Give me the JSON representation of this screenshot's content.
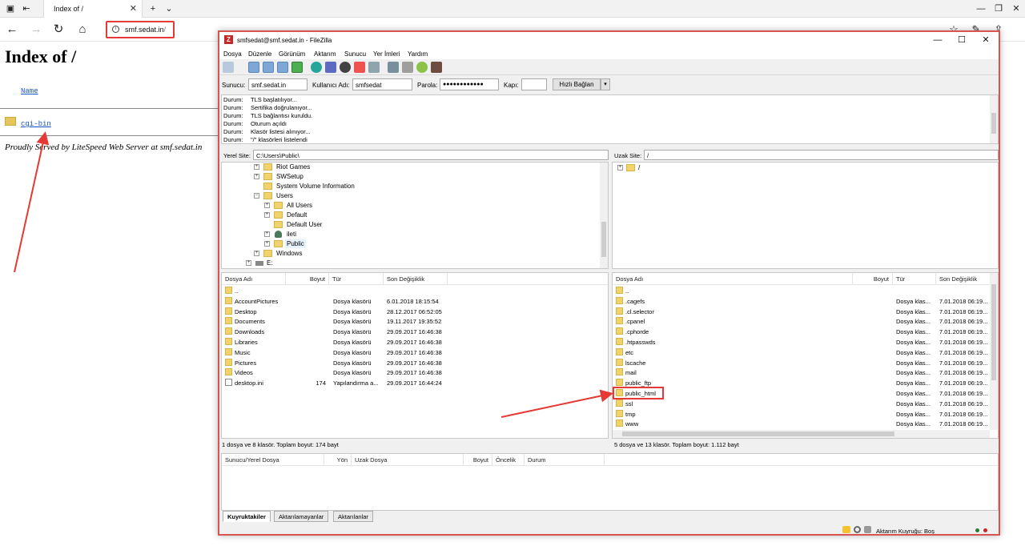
{
  "browser": {
    "tab_title": "Index of /",
    "url_host": "smf.sedat.in",
    "url_path": "/"
  },
  "page": {
    "heading": "Index of /",
    "column_name": "Name",
    "entries": [
      "cgi-bin"
    ],
    "footer": "Proudly Served by LiteSpeed Web Server at smf.sedat.in"
  },
  "filezilla": {
    "title": "smfsedat@smf.sedat.in - FileZilla",
    "menu": [
      "Dosya",
      "Düzenle",
      "Görünüm",
      "Aktarım",
      "Sunucu",
      "Yer İmleri",
      "Yardım"
    ],
    "quickconnect": {
      "host_label": "Sunucu:",
      "host_value": "smf.sedat.in",
      "user_label": "Kullanıcı Adı:",
      "user_value": "smfsedat",
      "pass_label": "Parola:",
      "pass_value": "●●●●●●●●●●●●",
      "port_label": "Kapı:",
      "port_value": "",
      "button": "Hızlı Bağlan"
    },
    "log": [
      {
        "k": "Durum:",
        "v": "TLS başlatılıyor..."
      },
      {
        "k": "Durum:",
        "v": "Sertifika doğrulanıyor..."
      },
      {
        "k": "Durum:",
        "v": "TLS bağlantısı kuruldu."
      },
      {
        "k": "Durum:",
        "v": "Oturum açıldı"
      },
      {
        "k": "Durum:",
        "v": "Klasör listesi alınıyor..."
      },
      {
        "k": "Durum:",
        "v": "\"/\" klasörleri listelendi"
      }
    ],
    "local": {
      "site_label": "Yerel Site:",
      "site_path": "C:\\Users\\Public\\",
      "tree": [
        "Riot Games",
        "SWSetup",
        "System Volume Information",
        "Users",
        "All Users",
        "Default",
        "Default User",
        "ileti",
        "Public",
        "Windows",
        "E:"
      ],
      "headers": [
        "Dosya Adı",
        "Boyut",
        "Tür",
        "Son Değişiklik"
      ],
      "files": [
        {
          "name": "..",
          "size": "",
          "type": "",
          "date": ""
        },
        {
          "name": "AccountPictures",
          "size": "",
          "type": "Dosya klasörü",
          "date": "6.01.2018 18:15:54"
        },
        {
          "name": "Desktop",
          "size": "",
          "type": "Dosya klasörü",
          "date": "28.12.2017 06:52:05"
        },
        {
          "name": "Documents",
          "size": "",
          "type": "Dosya klasörü",
          "date": "19.11.2017 19:35:52"
        },
        {
          "name": "Downloads",
          "size": "",
          "type": "Dosya klasörü",
          "date": "29.09.2017 16:46:38"
        },
        {
          "name": "Libraries",
          "size": "",
          "type": "Dosya klasörü",
          "date": "29.09.2017 16:46:38"
        },
        {
          "name": "Music",
          "size": "",
          "type": "Dosya klasörü",
          "date": "29.09.2017 16:46:38"
        },
        {
          "name": "Pictures",
          "size": "",
          "type": "Dosya klasörü",
          "date": "29.09.2017 16:46:38"
        },
        {
          "name": "Videos",
          "size": "",
          "type": "Dosya klasörü",
          "date": "29.09.2017 16:46:38"
        },
        {
          "name": "desktop.ini",
          "size": "174",
          "type": "Yapılandırma a...",
          "date": "29.09.2017 16:44:24"
        }
      ],
      "status": "1 dosya ve 8 klasör. Toplam boyut: 174 bayt"
    },
    "remote": {
      "site_label": "Uzak Site:",
      "site_path": "/",
      "tree_root": "/",
      "headers": [
        "Dosya Adı",
        "Boyut",
        "Tür",
        "Son Değişiklik"
      ],
      "files": [
        {
          "name": "..",
          "type": "",
          "date": ""
        },
        {
          "name": ".cagefs",
          "type": "Dosya klas...",
          "date": "7.01.2018 06:19..."
        },
        {
          "name": ".cl.selector",
          "type": "Dosya klas...",
          "date": "7.01.2018 06:19..."
        },
        {
          "name": ".cpanel",
          "type": "Dosya klas...",
          "date": "7.01.2018 06:19..."
        },
        {
          "name": ".cphorde",
          "type": "Dosya klas...",
          "date": "7.01.2018 06:19..."
        },
        {
          "name": ".htpasswds",
          "type": "Dosya klas...",
          "date": "7.01.2018 06:19..."
        },
        {
          "name": "etc",
          "type": "Dosya klas...",
          "date": "7.01.2018 06:19..."
        },
        {
          "name": "lscache",
          "type": "Dosya klas...",
          "date": "7.01.2018 06:19..."
        },
        {
          "name": "mail",
          "type": "Dosya klas...",
          "date": "7.01.2018 06:19..."
        },
        {
          "name": "public_ftp",
          "type": "Dosya klas...",
          "date": "7.01.2018 06:19..."
        },
        {
          "name": "public_html",
          "type": "Dosya klas...",
          "date": "7.01.2018 06:19..."
        },
        {
          "name": "ssl",
          "type": "Dosya klas...",
          "date": "7.01.2018 06:19..."
        },
        {
          "name": "tmp",
          "type": "Dosya klas...",
          "date": "7.01.2018 06:19..."
        },
        {
          "name": "www",
          "type": "Dosya klas...",
          "date": "7.01.2018 06:19..."
        }
      ],
      "status": "5 dosya ve 13 klasör. Toplam boyut: 1.112 bayt"
    },
    "queue": {
      "headers": [
        "Sunucu/Yerel Dosya",
        "Yön",
        "Uzak Dosya",
        "Boyut",
        "Öncelik",
        "Durum"
      ],
      "tabs": [
        "Kuyruktakiler",
        "Aktarılamayanlar",
        "Aktarılanlar"
      ],
      "status": "Aktarım Kuyruğu: Boş"
    },
    "colors": {
      "highlight": "#e53935",
      "folder": "#f2d36b"
    }
  }
}
